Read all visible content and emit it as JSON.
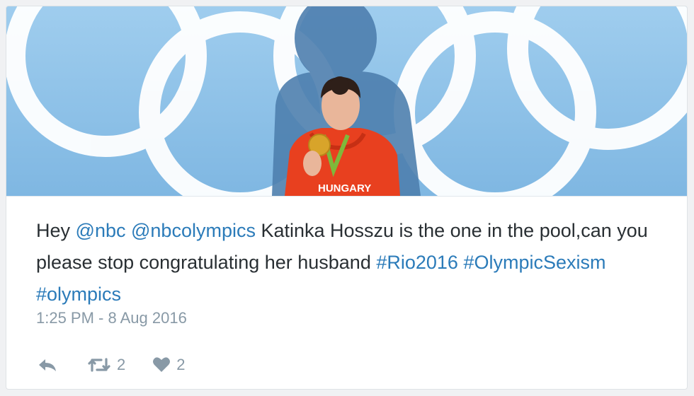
{
  "tweet": {
    "text": {
      "p1": "Hey ",
      "mention1": "@nbc",
      "p2": " ",
      "mention2": "@nbcolympics",
      "p3": " Katinka Hosszu is the one in the pool,can you please stop congratulating her husband ",
      "hashtag1": "#Rio2016",
      "p4": " ",
      "hashtag2": "#OlympicSexism",
      "p5": " ",
      "hashtag3": "#olympics"
    },
    "timestamp": "1:25 PM - 8 Aug 2016",
    "retweet_count": "2",
    "like_count": "2"
  },
  "photo": {
    "jacket_text": "HUNGARY"
  },
  "colors": {
    "link": "#2b7bb9",
    "text": "#292f33",
    "muted": "#8899a6",
    "photo_bg": "#8ec3e8",
    "jacket": "#e8401f"
  },
  "icons": [
    "reply-icon",
    "retweet-icon",
    "heart-icon"
  ]
}
